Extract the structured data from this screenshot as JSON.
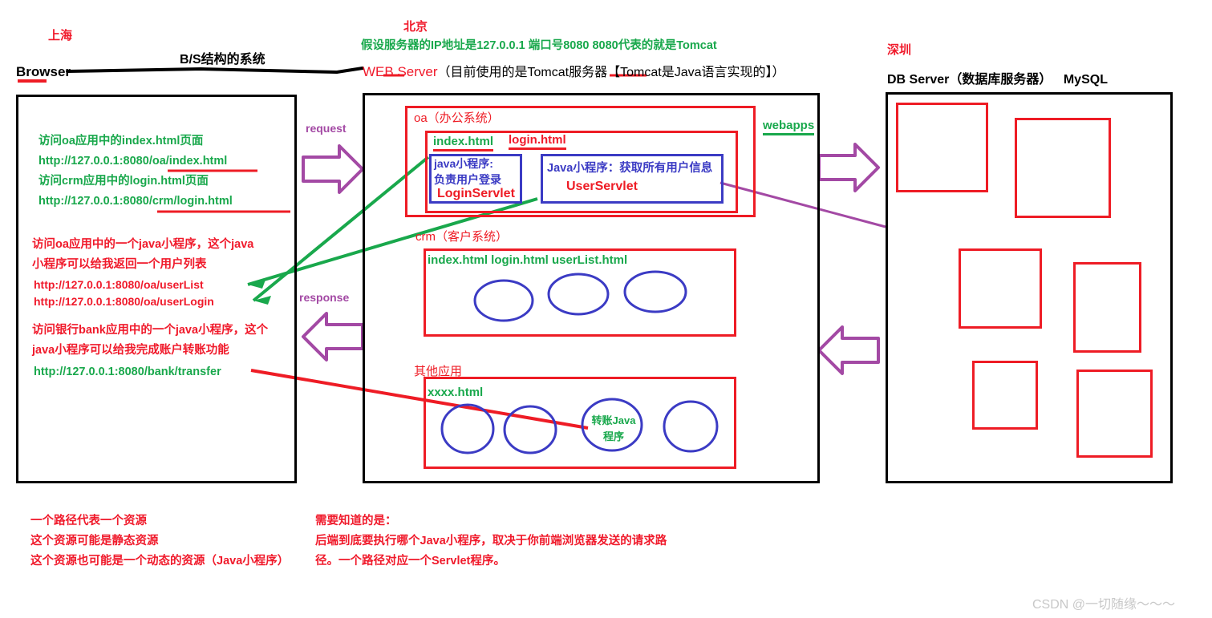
{
  "diagram": {
    "title_bs": "B/S结构的系统",
    "watermark": "CSDN @一切随缘～～～"
  },
  "browser_panel": {
    "city": "上海",
    "label": "Browser",
    "notes_green": [
      "访问oa应用中的index.html页面",
      "http://127.0.0.1:8080/oa/index.html",
      "访问crm应用中的login.html页面",
      "http://127.0.0.1:8080/crm/login.html"
    ],
    "note_red_1": [
      "访问oa应用中的一个java小程序，这个java",
      "小程序可以给我返回一个用户列表",
      "http://127.0.0.1:8080/oa/userList",
      "http://127.0.0.1:8080/oa/userLogin"
    ],
    "note_red_2": [
      "访问银行bank应用中的一个java小程序，这个",
      "java小程序可以给我完成账户转账功能"
    ],
    "note_bank_url": "http://127.0.0.1:8080/bank/transfer"
  },
  "web_server_panel": {
    "city": "北京",
    "ip_note": "假设服务器的IP地址是127.0.0.1 端口号8080    8080代表的就是Tomcat",
    "label": "WEB Server",
    "label_note_a": "（目前使用的是Tomcat服务器【",
    "label_note_b": "Tomcat",
    "label_note_c": "是Java语言实现的】）",
    "webapps_label": "webapps",
    "apps": [
      {
        "title": "oa（办公系统）",
        "files_green": "index.html",
        "files_red": "login.html",
        "servlets": [
          {
            "line1": "java小程序:",
            "line2": "负责用户登录",
            "name": "LoginServlet"
          },
          {
            "line1": "Java小程序：获取所有用户信息",
            "name": "UserServlet"
          }
        ]
      },
      {
        "title": "crm（客户系统）",
        "files": "index.html  login.html userList.html",
        "circles": 3
      },
      {
        "title": "其他应用",
        "files": "xxxx.html",
        "circles": 4,
        "circle_label_line1": "转账Java",
        "circle_label_line2": "程序"
      }
    ],
    "arrows": {
      "request": "request",
      "response": "response"
    }
  },
  "db_panel": {
    "city": "深圳",
    "label": "DB Server（数据库服务器）",
    "engine": "MySQL",
    "box_count": 6
  },
  "footnotes": {
    "left": [
      "一个路径代表一个资源",
      "这个资源可能是静态资源",
      "这个资源也可能是一个动态的资源（Java小程序）"
    ],
    "middle": [
      "需要知道的是：",
      "      后端到底要执行哪个Java小程序，取决于你前端浏览器发送的请求路",
      "径。一个路径对应一个Servlet程序。"
    ]
  },
  "colors": {
    "red": "#ee1c25",
    "green": "#19a84c",
    "blue": "#3b3bc4",
    "purple": "#a349a4",
    "black": "#000000",
    "watermark": "#c8c8c8"
  }
}
